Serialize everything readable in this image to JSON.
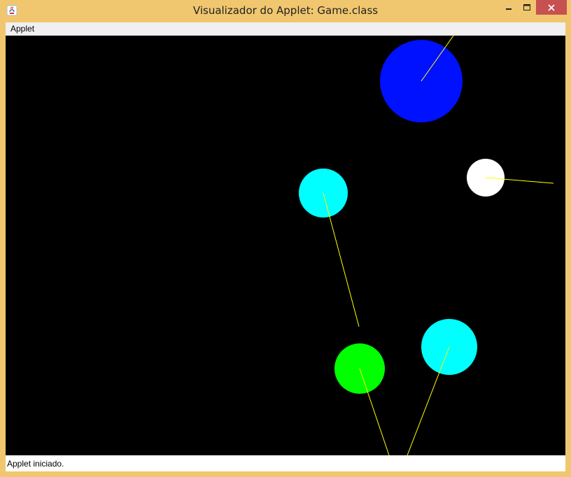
{
  "window": {
    "title": "Visualizador do Applet: Game.class",
    "close_color": "#c75050",
    "frame_color": "#f0c76f"
  },
  "menubar": {
    "items": [
      {
        "label": "Applet"
      }
    ]
  },
  "game": {
    "background": "#000000",
    "line_color": "#ffff00",
    "balls": [
      {
        "name": "blue-ball",
        "color": "#0011ff"
      },
      {
        "name": "white-ball",
        "color": "#ffffff"
      },
      {
        "name": "cyan-ball",
        "color": "#00ffff"
      },
      {
        "name": "green-ball",
        "color": "#00ff00"
      },
      {
        "name": "cyan-ball",
        "color": "#00ffff"
      }
    ]
  },
  "status": {
    "text": "Applet iniciado."
  }
}
